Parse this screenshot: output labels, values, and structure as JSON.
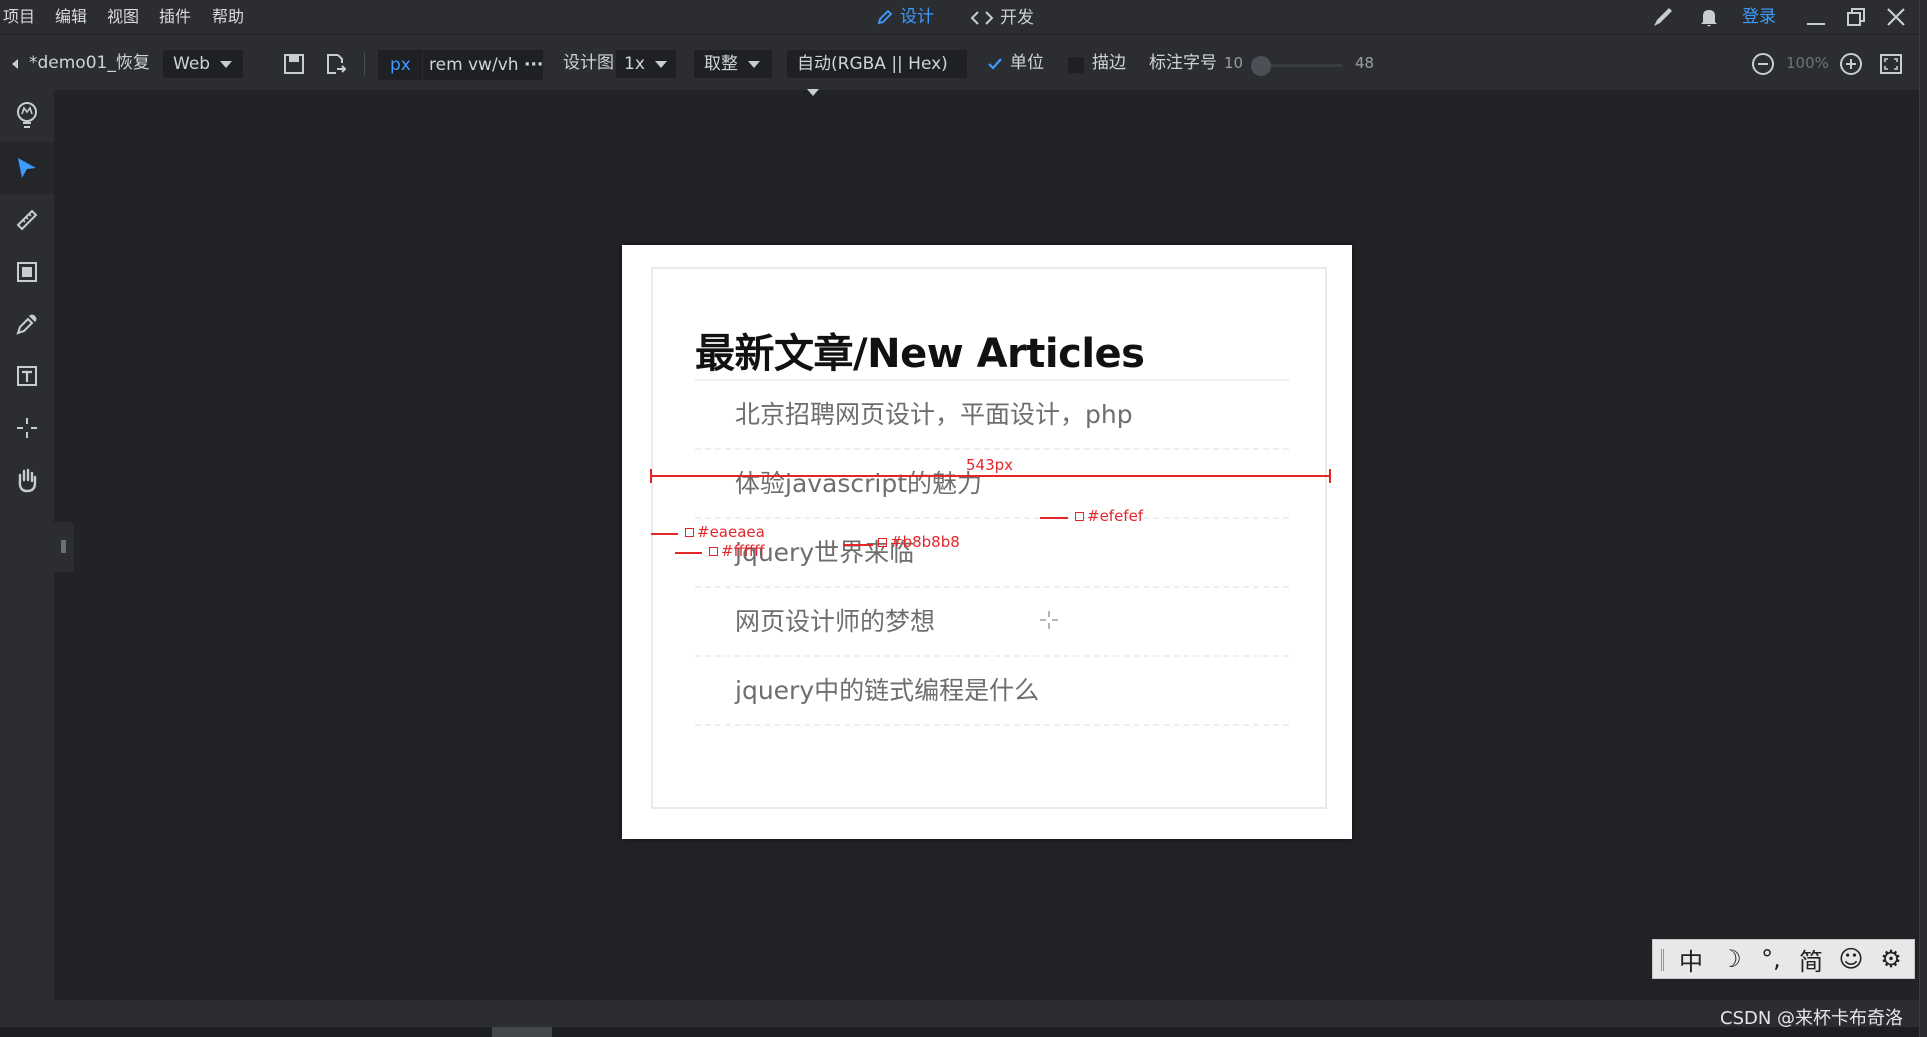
{
  "menu": {
    "items": [
      "项目",
      "编辑",
      "视图",
      "插件",
      "帮助"
    ],
    "design_tab": "设计",
    "dev_tab": "开发",
    "login": "登录"
  },
  "toolbar": {
    "file_name": "*demo01_恢复",
    "platform": "Web",
    "unit_px": "px",
    "unit_rem": "rem",
    "unit_vw": "vw/vh",
    "unit_more": "···",
    "design_label": "设计图",
    "design_scale": "1x",
    "rounding": "取整",
    "color_format": "自动(RGBA || Hex)",
    "unit_label": "单位",
    "stroke_label": "描边",
    "font_size_label": "标注字号",
    "font_size_min": "10",
    "font_size_max": "48",
    "font_size_value": 10,
    "zoom": "100%"
  },
  "sidebar": {
    "tools": [
      "lightbulb-icon",
      "pointer-icon",
      "ruler-icon",
      "slice-icon",
      "eyedropper-icon",
      "text-icon",
      "crosshair-icon",
      "hand-icon"
    ],
    "active_index": 1
  },
  "article": {
    "title": "最新文章/New Articles",
    "items": [
      "北京招聘网页设计，平面设计，php",
      "体验javascript的魅力",
      "jquery世界来临",
      "网页设计师的梦想",
      "jquery中的链式编程是什么"
    ]
  },
  "annotations": {
    "width_label": "543px",
    "color_efefef": "#efefef",
    "color_eaeaea": "#eaeaea",
    "color_ffffff": "#ffffff",
    "color_b8b8b8": "#b8b8b8"
  },
  "ime": {
    "items": [
      "中",
      "☽",
      "°,",
      "简",
      "☺",
      "⚙"
    ]
  },
  "watermark": "CSDN @来杯卡布奇洛",
  "colors": {
    "accent": "#3d9bff",
    "annotation": "#e4262b",
    "background": "#212327",
    "panel": "#2b2d31"
  }
}
